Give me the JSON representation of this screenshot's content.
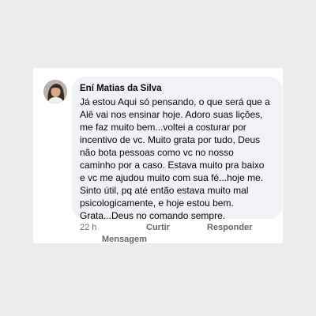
{
  "comment": {
    "author": "Ení Matias da Silva",
    "text_lines": [
      "Já estou Aqui só pensando, o que será que a",
      "Alê vai nos ensinar hoje. Adoro suas lições,",
      "me faz muito bem...voltei a costurar por",
      "incentivo de vc. Muito grata por tudo, Deus",
      "não bota pessoas como vc no nosso",
      "caminho por a caso. Estava muito pra baixo",
      "e vc me ajudou muito com sua fé...hoje me.",
      "Sinto útil, pq até então estava muito mal",
      "psicologicamente, e hoje estou bem.",
      "Grata...Deus no comando sempre."
    ],
    "time": "22 h",
    "actions": {
      "like": "Curtir",
      "reply": "Responder",
      "message": "Mensagem"
    }
  },
  "colors": {
    "background": "#ececec",
    "card": "#ffffff",
    "bubble": "#f0f2f5",
    "text": "#050505",
    "meta": "#65676b"
  }
}
